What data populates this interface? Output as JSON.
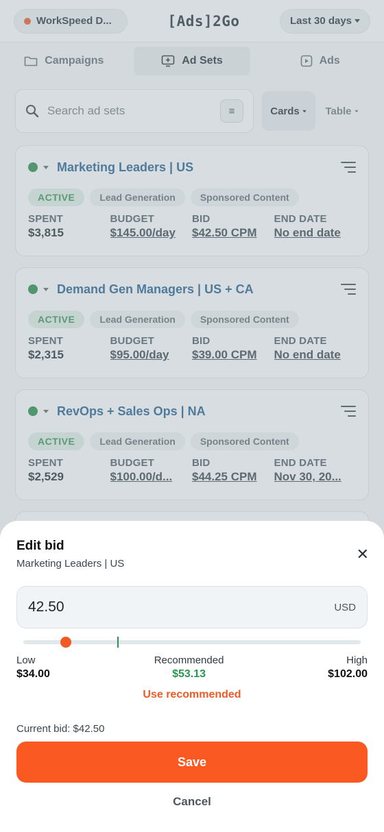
{
  "header": {
    "account": "WorkSpeed D...",
    "brand": "[Ads]2Go",
    "date_range": "Last 30 days"
  },
  "tabs": [
    {
      "label": "Campaigns",
      "icon": "folder-icon"
    },
    {
      "label": "Ad Sets",
      "icon": "adset-icon"
    },
    {
      "label": "Ads",
      "icon": "ad-icon"
    }
  ],
  "search": {
    "placeholder": "Search ad sets"
  },
  "view": {
    "cards": "Cards",
    "table": "Table"
  },
  "stat_labels": {
    "spent": "SPENT",
    "budget": "BUDGET",
    "bid": "BID",
    "end": "END DATE"
  },
  "adsets": [
    {
      "name": "Marketing Leaders | US",
      "status": "ACTIVE",
      "objective": "Lead Generation",
      "format": "Sponsored Content",
      "spent": "$3,815",
      "budget": "$145.00/day",
      "bid": "$42.50 CPM",
      "end": "No end date"
    },
    {
      "name": "Demand Gen Managers | US + CA",
      "status": "ACTIVE",
      "objective": "Lead Generation",
      "format": "Sponsored Content",
      "spent": "$2,315",
      "budget": "$95.00/day",
      "bid": "$39.00 CPM",
      "end": "No end date"
    },
    {
      "name": "RevOps + Sales Ops | NA",
      "status": "ACTIVE",
      "objective": "Lead Generation",
      "format": "Sponsored Content",
      "spent": "$2,529",
      "budget": "$100.00/d...",
      "bid": "$44.25 CPM",
      "end": "Nov 30, 20..."
    }
  ],
  "sheet": {
    "title": "Edit bid",
    "subtitle": "Marketing Leaders | US",
    "bid_value": "42.50",
    "currency": "USD",
    "slider": {
      "min": 34.0,
      "max": 102.0,
      "value": 42.5,
      "recommended": 53.13
    },
    "low_label": "Low",
    "low_value": "$34.00",
    "rec_label": "Recommended",
    "rec_value": "$53.13",
    "high_label": "High",
    "high_value": "$102.00",
    "use_recommended": "Use recommended",
    "current_bid": "Current bid: $42.50",
    "save": "Save",
    "cancel": "Cancel"
  },
  "colors": {
    "accent": "#fa5a22",
    "active_green": "#2f8f55",
    "link_blue": "#1f5d8c"
  }
}
